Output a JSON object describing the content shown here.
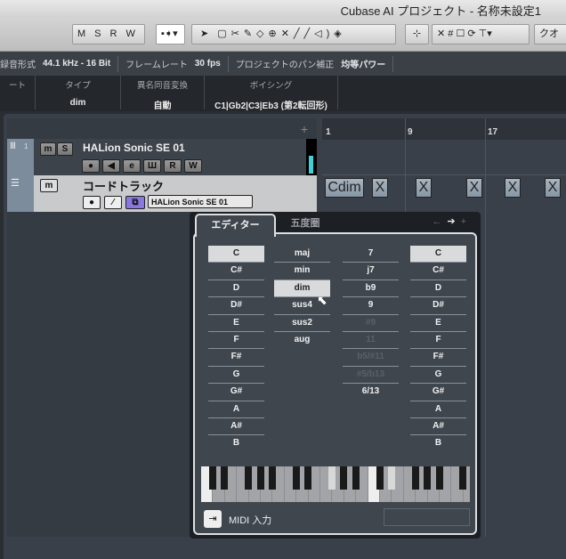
{
  "window": {
    "title": "Cubase AI プロジェクト - 名称未設定1"
  },
  "toolbar": {
    "msrw": [
      "M",
      "S",
      "R",
      "W"
    ],
    "tools": [
      "arrow-icon",
      "range-icon",
      "split-icon",
      "glue-icon",
      "erase-icon",
      "zoom-icon",
      "mute-icon",
      "pencil-icon",
      "line-icon",
      "speaker-icon",
      "color-icon"
    ],
    "snap_label": "クオ"
  },
  "infobar": {
    "items": [
      {
        "label": "録音形式",
        "value": "44.1 kHz - 16 Bit"
      },
      {
        "label": "フレームレート",
        "value": "30 fps"
      },
      {
        "label": "プロジェクトのパン補正",
        "value": "均等パワー"
      }
    ]
  },
  "inspector": {
    "columns": [
      {
        "label": "ート",
        "value": ""
      },
      {
        "label": "タイプ",
        "value": "dim"
      },
      {
        "label": "異名同音変換",
        "value": "自動"
      },
      {
        "label": "ボイシング",
        "value": "C1|Gb2|C3|Eb3 (第2転回形)"
      }
    ]
  },
  "tracks": [
    {
      "number": "1",
      "name": "HALion Sonic SE 01",
      "m": "m",
      "s": "S",
      "buttons": [
        "●",
        "◀",
        "e",
        "Ш",
        "R",
        "W"
      ]
    },
    {
      "name": "コードトラック",
      "m": "m",
      "instrument": "HALion Sonic SE 01"
    }
  ],
  "ruler": {
    "add": "+",
    "bars": [
      "1",
      "9",
      "17"
    ]
  },
  "chord_events": [
    "Cdim",
    "X",
    "X",
    "X",
    "X",
    "X"
  ],
  "popup": {
    "tabs": [
      "エディター",
      "五度圏"
    ],
    "roots": [
      "C",
      "C#",
      "D",
      "D#",
      "E",
      "F",
      "F#",
      "G",
      "G#",
      "A",
      "A#",
      "B"
    ],
    "types": [
      "maj",
      "min",
      "dim",
      "sus4",
      "sus2",
      "aug"
    ],
    "tensions": [
      {
        "t": "7",
        "on": true
      },
      {
        "t": "j7",
        "on": true
      },
      {
        "t": "b9",
        "on": true
      },
      {
        "t": "9",
        "on": true
      },
      {
        "t": "#9",
        "on": false
      },
      {
        "t": "11",
        "on": false
      },
      {
        "t": "b5/#11",
        "on": false
      },
      {
        "t": "#5/b13",
        "on": false
      },
      {
        "t": "6/13",
        "on": true
      }
    ],
    "bass": [
      "C",
      "C#",
      "D",
      "D#",
      "E",
      "F",
      "F#",
      "G",
      "G#",
      "A",
      "A#",
      "B"
    ],
    "selected_root": "C",
    "selected_type": "dim",
    "selected_bass": "C",
    "midi_input_label": "MIDI 入力",
    "highlighted_keys": [
      "C1",
      "Gb2",
      "C3",
      "Eb3"
    ]
  }
}
